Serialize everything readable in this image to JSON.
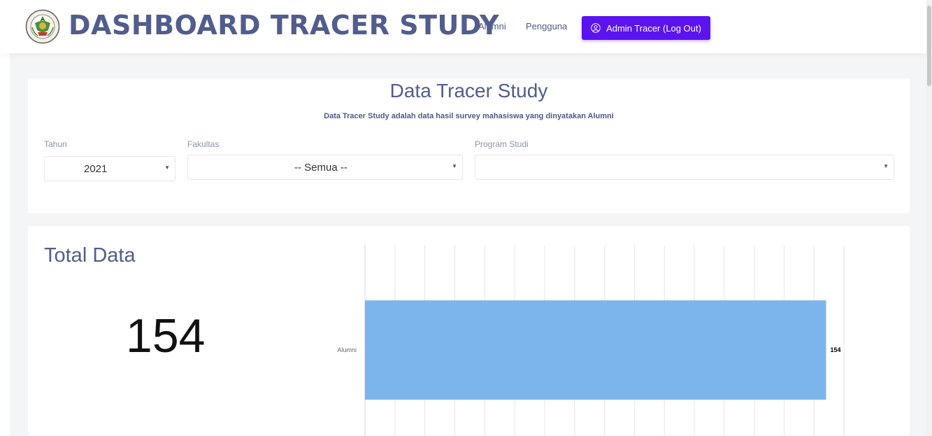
{
  "header": {
    "brand": "DASHBOARD TRACER STUDY",
    "nav_alumni": "Alumni",
    "nav_pengguna": "Pengguna",
    "admin_button": "Admin Tracer (Log Out)"
  },
  "filter": {
    "title": "Data Tracer Study",
    "subtitle": "Data Tracer Study adalah data hasil survey mahasiswa yang dinyatakan Alumni",
    "tahun_label": "Tahun",
    "tahun_value": "2021",
    "fakultas_label": "Fakultas",
    "fakultas_value": "-- Semua --",
    "prodi_label": "Program Studi",
    "prodi_value": ""
  },
  "total": {
    "title": "Total Data",
    "value": "154"
  },
  "colors": {
    "accent": "#5b14f0",
    "title": "#515d8c",
    "bar": "#7cb5ec"
  },
  "chart_data": {
    "type": "bar",
    "orientation": "horizontal",
    "categories": [
      "Alumni"
    ],
    "values": [
      154
    ],
    "data_labels": [
      "154"
    ],
    "grid": true
  }
}
